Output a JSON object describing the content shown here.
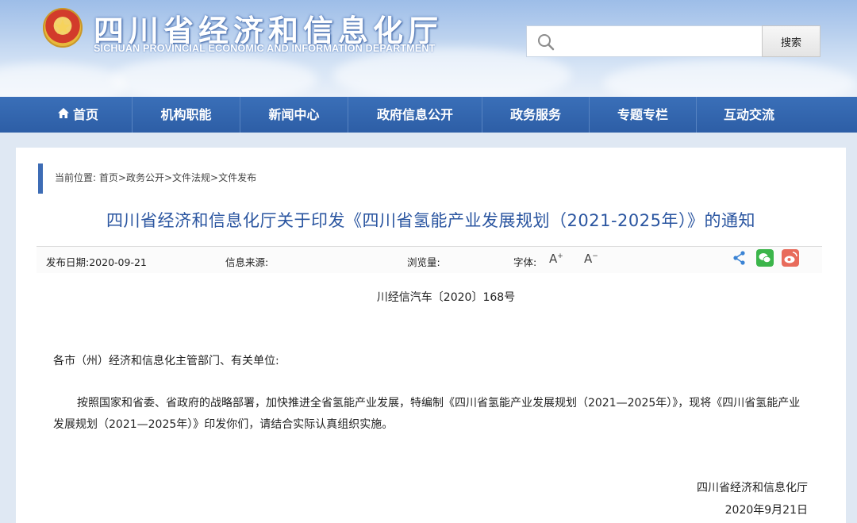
{
  "header": {
    "title": "四川省经济和信息化厅",
    "subtitle": "SICHUAN PROVINCIAL ECONOMIC AND INFORMATION DEPARTMENT",
    "search": {
      "placeholder": "",
      "button_label": "搜索"
    }
  },
  "nav": {
    "items": [
      {
        "label": "首页"
      },
      {
        "label": "机构职能"
      },
      {
        "label": "新闻中心"
      },
      {
        "label": "政府信息公开"
      },
      {
        "label": "政务服务"
      },
      {
        "label": "专题专栏"
      },
      {
        "label": "互动交流"
      }
    ]
  },
  "breadcrumb": {
    "prefix": "当前位置:",
    "items": [
      "首页",
      "政务公开",
      "文件法规",
      "文件发布"
    ],
    "separator": ">"
  },
  "article": {
    "title": "四川省经济和信息化厅关于印发《四川省氢能产业发展规划（2021-2025年）》的通知",
    "meta": {
      "publish_date": "发布日期:2020-09-21",
      "source": "信息来源:",
      "views": "浏览量:",
      "font_label": "字体:",
      "font_increase": "A",
      "font_decrease": "A"
    },
    "doc_number": "川经信汽车〔2020〕168号",
    "salutation": "各市（州）经济和信息化主管部门、有关单位:",
    "body": "按照国家和省委、省政府的战略部署，加快推进全省氢能产业发展，特编制《四川省氢能产业发展规划（2021—2025年）》，现将《四川省氢能产业发展规划（2021—2025年）》印发你们，请结合实际认真组织实施。",
    "signature": "四川省经济和信息化厅",
    "date": "2020年9月21日"
  },
  "colors": {
    "nav_bg": "#2d5ea6",
    "title_blue": "#2a55a0",
    "breadcrumb_bar": "#3d6cb5",
    "wechat": "#3bb54a",
    "weibo": "#e86b5b"
  }
}
